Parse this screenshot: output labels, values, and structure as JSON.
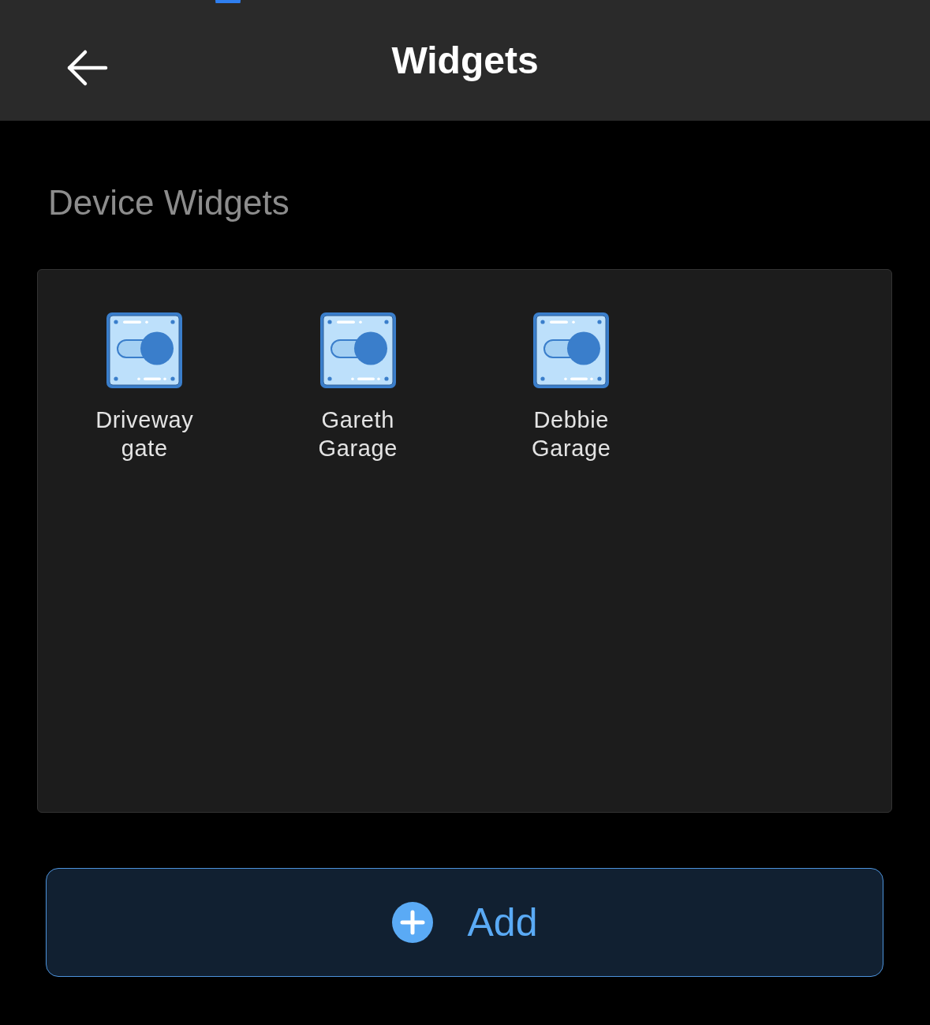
{
  "header": {
    "title": "Widgets"
  },
  "section": {
    "heading": "Device Widgets"
  },
  "widgets": [
    {
      "label": "Driveway gate"
    },
    {
      "label": "Gareth Garage"
    },
    {
      "label": "Debbie Garage"
    }
  ],
  "add_button": {
    "label": "Add"
  }
}
